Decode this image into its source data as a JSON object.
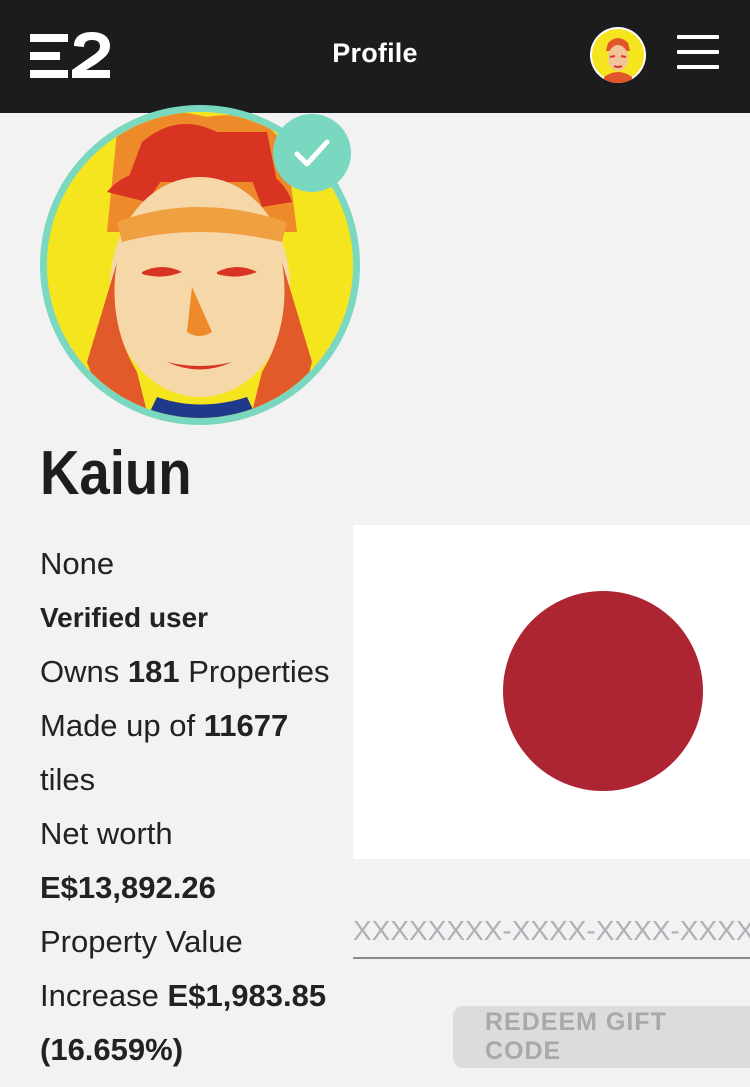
{
  "header": {
    "title": "Profile",
    "logo_icon": "e2-logo-icon",
    "menu_icon": "hamburger-menu-icon"
  },
  "profile": {
    "username": "Kaiun",
    "verified": true,
    "bio": "None",
    "verified_label": "Verified user",
    "owns_prefix": "Owns",
    "properties_count": "181",
    "owns_suffix": "Properties",
    "made_up_prefix": "Made up of",
    "tiles_count": "11677",
    "tiles_suffix": "tiles",
    "net_worth_label": "Net worth",
    "net_worth_value": "E$13,892.26",
    "property_value_label": "Property Value",
    "increase_label": "Increase",
    "increase_value": "E$1,983.85",
    "increase_percent": "(16.659%)"
  },
  "country_flag": {
    "icon": "japan-flag-icon",
    "background_color": "#ffffff",
    "disc_color": "#ad2433"
  },
  "gift_code": {
    "placeholder": "XXXXXXXX-XXXX-XXXX-XXXX-XXXXXXXXXXXX",
    "button_label": "REDEEM GIFT CODE"
  },
  "colors": {
    "header_bg": "#1c1c1e",
    "accent_teal": "#7ad7c0",
    "page_bg": "#f2f2f2"
  }
}
